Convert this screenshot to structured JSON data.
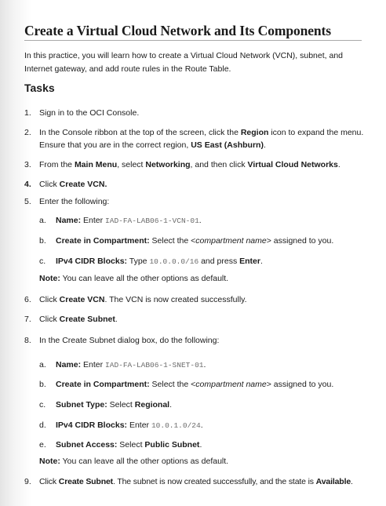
{
  "title": "Create a Virtual Cloud Network and Its Components",
  "intro": "In this practice, you will learn how to create a Virtual Cloud Network (VCN), subnet, and Internet gateway, and add route rules in the Route Table.",
  "tasks_heading": "Tasks",
  "steps": {
    "s1": {
      "num": "1.",
      "text": "Sign in to the OCI Console."
    },
    "s2": {
      "num": "2.",
      "a": "In the Console ribbon at the top of the screen, click the ",
      "b": "Region",
      "c": " icon to expand the menu.",
      "line2a": "Ensure that you are in the correct region, ",
      "line2b": "US East (Ashburn)",
      "line2c": "."
    },
    "s3": {
      "num": "3.",
      "a": "From the ",
      "b": "Main Menu",
      "c": ", select ",
      "d": "Networking",
      "e": ", and then click ",
      "f": "Virtual Cloud Networks",
      "g": "."
    },
    "s4": {
      "num": "4.",
      "a": "Click ",
      "b": "Create VCN."
    },
    "s5": {
      "num": "5.",
      "text": "Enter the following:",
      "a": {
        "letter": "a.",
        "label": "Name:",
        "text": " Enter ",
        "code": "IAD-FA-LAB06-1-VCN-01",
        "end": "."
      },
      "b": {
        "letter": "b.",
        "label": "Create in Compartment:",
        "text": " Select the <",
        "ital": "compartment name",
        "end": "> assigned to you."
      },
      "c": {
        "letter": "c.",
        "label": "IPv4 CIDR Blocks:",
        "text": " Type ",
        "code": "10.0.0.0/16",
        "mid": " and press ",
        "bold2": "Enter",
        "end": "."
      },
      "note_label": "Note:",
      "note_text": " You can leave all the other options as default."
    },
    "s6": {
      "num": "6.",
      "a": "Click ",
      "b": "Create VCN",
      "c": ". The VCN is now created successfully."
    },
    "s7": {
      "num": "7.",
      "a": "Click ",
      "b": "Create Subnet",
      "c": "."
    },
    "s8": {
      "num": "8.",
      "text": "In the Create Subnet dialog box, do the following:",
      "a": {
        "letter": "a.",
        "label": "Name:",
        "text": " Enter ",
        "code": "IAD-FA-LAB06-1-SNET-01",
        "end": "."
      },
      "b": {
        "letter": "b.",
        "label": "Create in Compartment:",
        "text": " Select the <",
        "ital": "compartment name",
        "end": "> assigned to you."
      },
      "c": {
        "letter": "c.",
        "label": "Subnet Type:",
        "text": " Select ",
        "bold2": "Regional",
        "end": "."
      },
      "d": {
        "letter": "d.",
        "label": "IPv4 CIDR Blocks:",
        "text": " Enter ",
        "code": "10.0.1.0/24",
        "end": "."
      },
      "e": {
        "letter": "e.",
        "label": "Subnet Access:",
        "text": " Select ",
        "bold2": "Public Subnet",
        "end": "."
      },
      "note_label": "Note:",
      "note_text": " You can leave all the other options as default."
    },
    "s9": {
      "num": "9.",
      "a": "Click ",
      "b": "Create Subnet",
      "c": ". The subnet is now created successfully, and the state is ",
      "d": "Available",
      "e": "."
    }
  }
}
